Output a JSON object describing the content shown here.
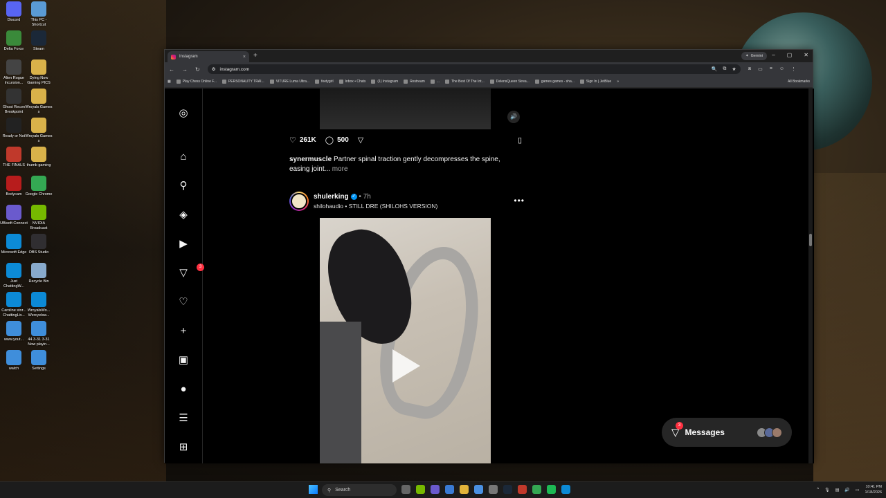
{
  "desktop": {
    "icons": [
      {
        "label": "Discord",
        "color": "#5865f2"
      },
      {
        "label": "This PC - Shortcut",
        "color": "#5a9bd5"
      },
      {
        "label": "Delta Force",
        "color": "#3a8a3a"
      },
      {
        "label": "Steam",
        "color": "#1b2838"
      },
      {
        "label": "Alien Rogue Incursion...",
        "color": "#444"
      },
      {
        "label": "Dying Now Gaming PICS",
        "color": "#d9b24a"
      },
      {
        "label": "Ghost Recon Breakpoint",
        "color": "#333"
      },
      {
        "label": "Wroyals Games s",
        "color": "#d9b24a"
      },
      {
        "label": "Ready or Not",
        "color": "#222"
      },
      {
        "label": "Wroyals Games s",
        "color": "#d9b24a"
      },
      {
        "label": "THE FINALS",
        "color": "#c0392b"
      },
      {
        "label": "thumb gaming",
        "color": "#d9b24a"
      },
      {
        "label": "Bodycam",
        "color": "#b71c1c"
      },
      {
        "label": "Google Chrome",
        "color": "#34a853"
      },
      {
        "label": "UBisoft Connect",
        "color": "#6a5acd"
      },
      {
        "label": "NVIDIA Broadcast",
        "color": "#76b900"
      },
      {
        "label": "Microsoft Edge",
        "color": "#0c8ad6"
      },
      {
        "label": "OBS Studio",
        "color": "#302e31"
      },
      {
        "label": "Just ChattingW...",
        "color": "#0c8ad6"
      },
      {
        "label": "Recycle Bin",
        "color": "#88aacc"
      },
      {
        "label": "Caroline stor... ChattingLiv...",
        "color": "#0c8ad6"
      },
      {
        "label": "WroyalsWo... Wercyelsw...",
        "color": "#0c8ad6"
      },
      {
        "label": "www.yout...",
        "color": "#3f8edb"
      },
      {
        "label": "44 3-31 3-31 Now playin...",
        "color": "#3f8edb"
      },
      {
        "label": "watch",
        "color": "#3f8edb"
      },
      {
        "label": "Settings",
        "color": "#3f8edb"
      }
    ]
  },
  "browser": {
    "tab_title": "Instagram",
    "tab_close": "×",
    "new_tab": "+",
    "gemini_label": "Gemini",
    "window_controls": {
      "minimize": "–",
      "maximize": "▢",
      "close": "✕"
    },
    "nav": {
      "back": "←",
      "forward": "→",
      "reload": "↻"
    },
    "url": "instagram.com",
    "bookmarks": [
      "Play Chess Online F...",
      "PERSONALITY TRAI...",
      "VITURE Luma Ultra...",
      "feetygirl",
      "Inbox • Chats",
      "(1) Instagram",
      "Restream",
      "...",
      "The Best Of The Int...",
      "DelensQueen Strea...",
      "games games - sha...",
      "Sign In | JetBlue"
    ],
    "all_bookmarks": "All Bookmarks"
  },
  "instagram": {
    "post1": {
      "likes": "261K",
      "comments": "500",
      "caption_user": "synermuscle",
      "caption_text": "Partner spinal traction gently decompresses the spine, easing joint...",
      "more": "more"
    },
    "post2": {
      "username": "shulerking",
      "time": "• 7h",
      "audio": "shilohaudio • STILL DRE (SHILOHS VERSION)",
      "menu": "•••"
    },
    "notifications_badge": "3",
    "messages": {
      "label": "Messages",
      "badge": "3"
    }
  },
  "taskbar": {
    "search_label": "Search",
    "time": "10:41 PM",
    "date": "1/18/2026"
  }
}
